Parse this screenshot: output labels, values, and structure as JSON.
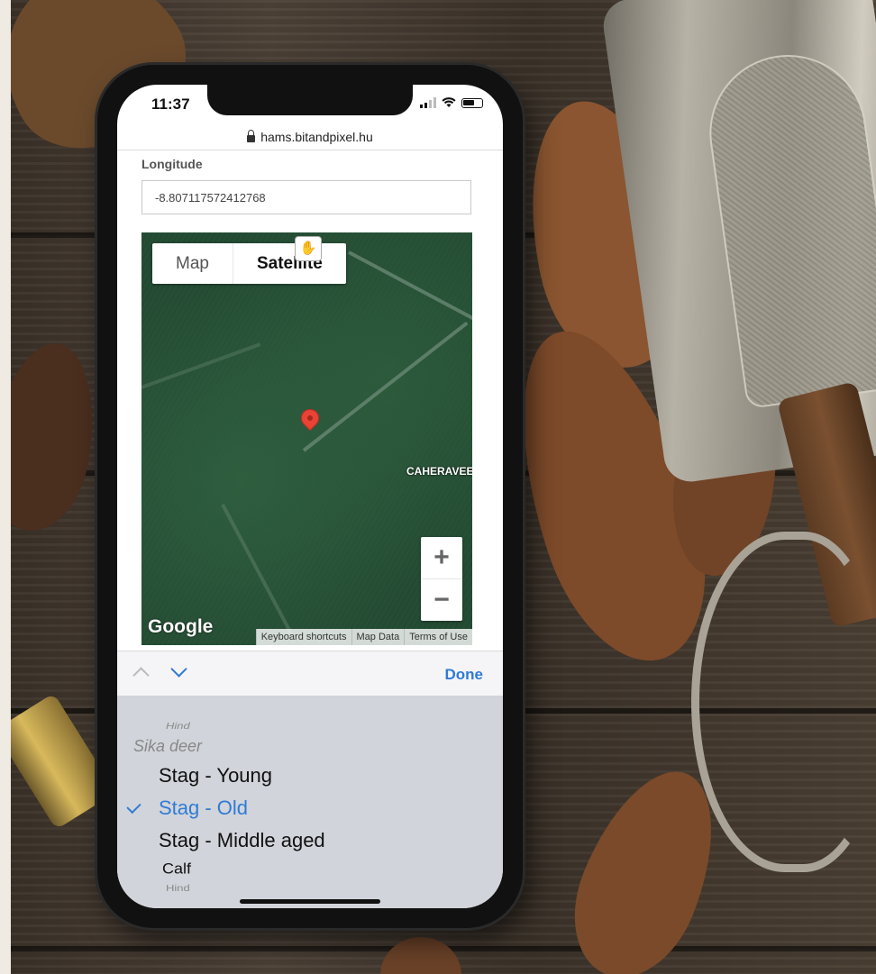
{
  "status_bar": {
    "time": "11:37"
  },
  "browser": {
    "url": "hams.bitandpixel.hu"
  },
  "form": {
    "longitude_label": "Longitude",
    "longitude_value": "-8.807117572412768"
  },
  "map": {
    "type_buttons": {
      "map": "Map",
      "satellite": "Satellite"
    },
    "place_label": "CAHERAVEE",
    "zoom_in": "+",
    "zoom_out": "−",
    "google_logo": "Google",
    "footer_links": [
      "Keyboard shortcuts",
      "Map Data",
      "Terms of Use"
    ]
  },
  "picker": {
    "done": "Done",
    "options": {
      "above_faint": "Hind",
      "group": "Sika deer",
      "young": "Stag - Young",
      "old": "Stag - Old",
      "middle": "Stag - Middle aged",
      "calf": "Calf",
      "below_faint": "Hind"
    },
    "selected": "Stag - Old"
  },
  "colors": {
    "accent": "#2f7bd6",
    "map_pin": "#ea4335"
  }
}
